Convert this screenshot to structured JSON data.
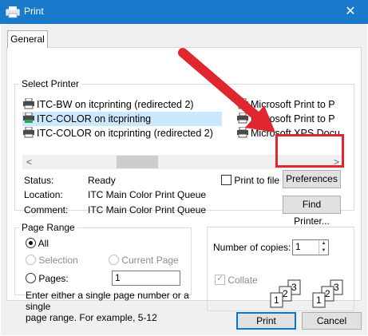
{
  "window": {
    "title": "Print",
    "close_glyph": "✕"
  },
  "tabs": [
    {
      "label": "General"
    }
  ],
  "select_printer": {
    "legend": "Select Printer",
    "printers": [
      {
        "name": "ITC-BW on itcprinting (redirected 2)",
        "selected": false
      },
      {
        "name": "ITC-COLOR on itcprinting",
        "selected": true
      },
      {
        "name": "ITC-COLOR on itcprinting (redirected 2)",
        "selected": false
      },
      {
        "name": "Microsoft Print to P",
        "selected": false
      },
      {
        "name": "Microsoft Print to P",
        "selected": false
      },
      {
        "name": "Microsoft XPS Docu",
        "selected": false
      }
    ],
    "scroll_left": "<",
    "scroll_right": ">",
    "status_label": "Status:",
    "status_value": "Ready",
    "location_label": "Location:",
    "location_value": "ITC Main Color Print Queue",
    "comment_label": "Comment:",
    "comment_value": "ITC Main Color Print Queue",
    "print_to_file_label": "Print to file",
    "print_to_file_checked": false,
    "preferences_label": "Preferences",
    "find_printer_label": "Find Printer..."
  },
  "page_range": {
    "legend": "Page Range",
    "all_label": "All",
    "selection_label": "Selection",
    "current_page_label": "Current Page",
    "pages_label": "Pages:",
    "pages_value": "1",
    "selected_option": "All",
    "hint_line1": "Enter either a single page number or a single",
    "hint_line2": "page range.  For example, 5-12"
  },
  "copies": {
    "number_label": "Number of copies:",
    "number_value": "1",
    "collate_label": "Collate",
    "collate_checked": true,
    "collate_enabled": false,
    "collate_digits": [
      "1",
      "2",
      "3"
    ]
  },
  "buttons": {
    "print_label": "Print",
    "cancel_label": "Cancel"
  },
  "annotation": {
    "color": "#e0262f",
    "target": "Preferences"
  },
  "colors": {
    "titlebar": "#1979ca",
    "selection": "#cce8ff",
    "default_button_border": "#0078d7"
  }
}
